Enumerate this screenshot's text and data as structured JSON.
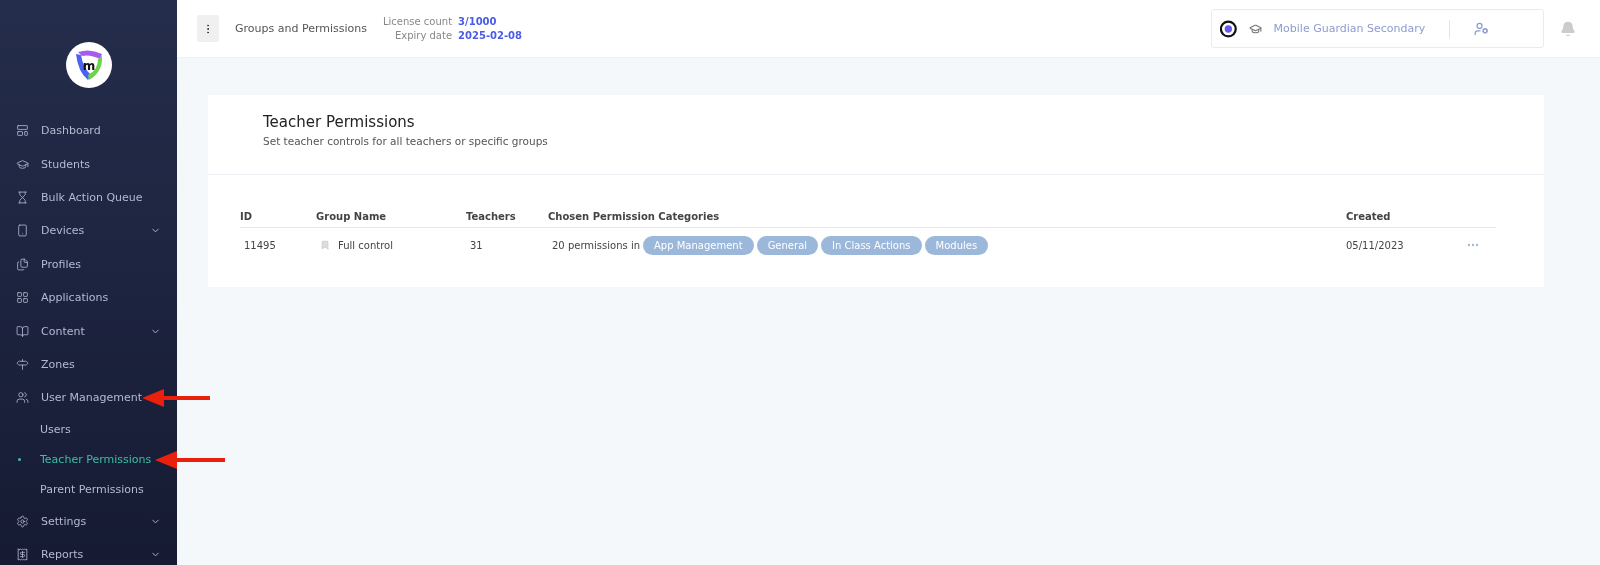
{
  "sidebar": {
    "logo_letter": "m",
    "items": [
      {
        "label": "Dashboard",
        "expandable": false,
        "selected": false
      },
      {
        "label": "Students",
        "expandable": false,
        "selected": false
      },
      {
        "label": "Bulk Action Queue",
        "expandable": false,
        "selected": false
      },
      {
        "label": "Devices",
        "expandable": true,
        "selected": false
      },
      {
        "label": "Profiles",
        "expandable": false,
        "selected": false
      },
      {
        "label": "Applications",
        "expandable": false,
        "selected": false
      },
      {
        "label": "Content",
        "expandable": true,
        "selected": false
      },
      {
        "label": "Zones",
        "expandable": false,
        "selected": false
      },
      {
        "label": "User Management",
        "expandable": false,
        "selected": false,
        "annotated": true,
        "children": [
          {
            "label": "Users",
            "selected": false
          },
          {
            "label": "Teacher Permissions",
            "selected": true,
            "annotated": true
          },
          {
            "label": "Parent Permissions",
            "selected": false
          }
        ]
      },
      {
        "label": "Settings",
        "expandable": true,
        "selected": false
      },
      {
        "label": "Reports",
        "expandable": true,
        "selected": false
      }
    ]
  },
  "topbar": {
    "title": "Groups and Permissions",
    "license_label": "License count",
    "license_value": "3/1000",
    "expiry_label": "Expiry date",
    "expiry_value": "2025-02-08",
    "school": "Mobile Guardian Secondary"
  },
  "card": {
    "title": "Teacher Permissions",
    "subtitle": "Set teacher controls for all teachers or specific groups"
  },
  "table": {
    "columns": [
      "ID",
      "Group Name",
      "Teachers",
      "Chosen Permission Categories",
      "Created"
    ],
    "rows": [
      {
        "id": "11495",
        "group": "Full control",
        "teachers": "31",
        "permissions_prefix": "20 permissions in",
        "categories": [
          "App Management",
          "General",
          "In Class Actions",
          "Modules"
        ],
        "created": "05/11/2023"
      }
    ]
  }
}
